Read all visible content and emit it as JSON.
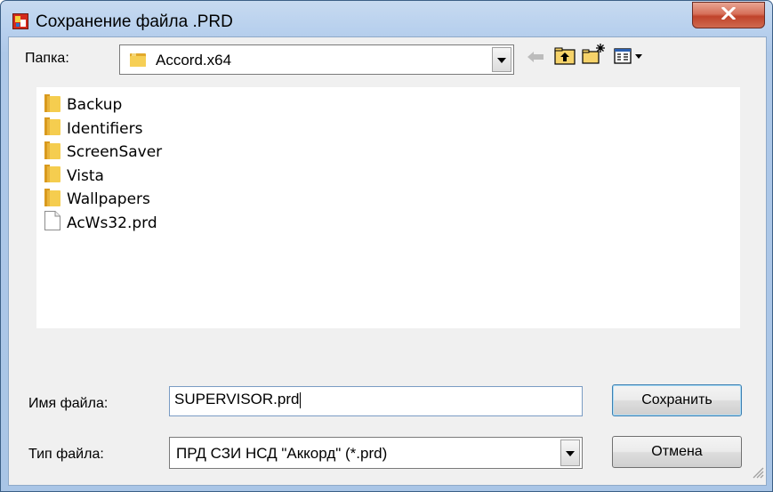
{
  "window": {
    "title": "Сохранение файла .PRD",
    "close_icon": "close-x-icon"
  },
  "folder": {
    "label": "Папка:",
    "value": "Accord.x64",
    "icon": "folder-icon"
  },
  "toolbar": {
    "back_icon": "back-arrow-icon",
    "up_icon": "up-folder-icon",
    "new_folder_icon": "new-folder-icon",
    "view_menu_icon": "view-menu-icon"
  },
  "files": [
    {
      "name": "Backup",
      "type": "folder"
    },
    {
      "name": "Identifiers",
      "type": "folder"
    },
    {
      "name": "ScreenSaver",
      "type": "folder"
    },
    {
      "name": "Vista",
      "type": "folder"
    },
    {
      "name": "Wallpapers",
      "type": "folder"
    },
    {
      "name": "AcWs32.prd",
      "type": "file"
    }
  ],
  "filename": {
    "label": "Имя файла:",
    "value": "SUPERVISOR.prd"
  },
  "filetype": {
    "label": "Тип файла:",
    "value": "ПРД СЗИ НСД \"Аккорд\" (*.prd)"
  },
  "buttons": {
    "save": "Сохранить",
    "cancel": "Отмена"
  },
  "colors": {
    "title_bar": "#b9d1ee",
    "close_button": "#c7503a",
    "dialog_bg": "#f0f0f0",
    "folder_yellow": "#f4c94a"
  }
}
